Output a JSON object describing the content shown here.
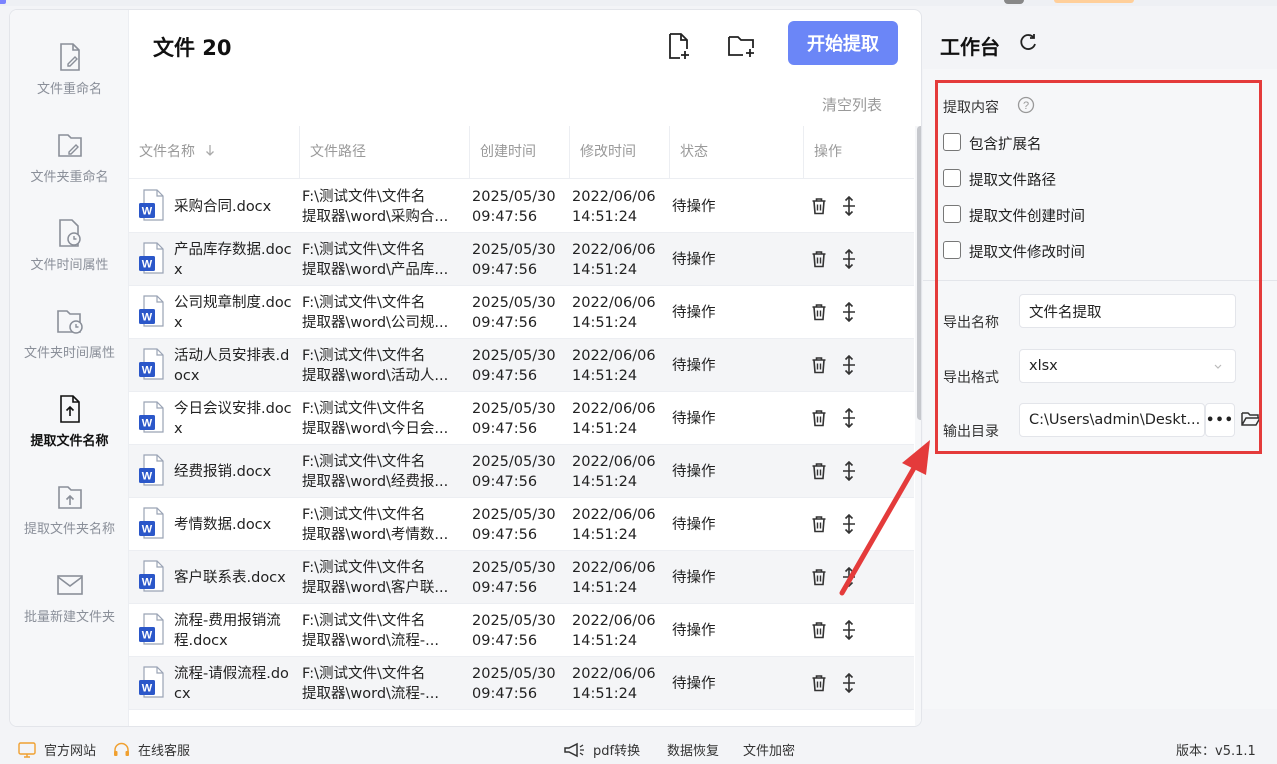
{
  "sidebar": {
    "items": [
      {
        "label": "文件重命名",
        "icon": "file-edit-icon",
        "active": false
      },
      {
        "label": "文件夹重命名",
        "icon": "folder-icon",
        "active": false
      },
      {
        "label": "文件时间属性",
        "icon": "file-clock-icon",
        "active": false
      },
      {
        "label": "文件夹时间属性",
        "icon": "folder-clock-icon",
        "active": false
      },
      {
        "label": "提取文件名称",
        "icon": "file-upload-icon",
        "active": true
      },
      {
        "label": "提取文件夹名称",
        "icon": "folder-upload-icon",
        "active": false
      },
      {
        "label": "批量新建文件夹",
        "icon": "folder-mail-icon",
        "active": false
      }
    ]
  },
  "header": {
    "file_count_title": "文件 20",
    "add_file_icon": "add-file-icon",
    "add_folder_icon": "add-folder-icon",
    "start_button": "开始提取",
    "clear_list": "清空列表"
  },
  "table": {
    "columns": [
      "文件名称",
      "文件路径",
      "创建时间",
      "修改时间",
      "状态",
      "操作"
    ],
    "sort_icon": "arrow-down-icon",
    "rows": [
      {
        "name": "采购合同.docx",
        "path1": "F:\\测试文件\\文件名",
        "path2": "提取器\\word\\采购合...",
        "created1": "2025/05/30",
        "created2": "09:47:56",
        "modified1": "2022/06/06",
        "modified2": "14:51:24",
        "status": "待操作"
      },
      {
        "name": "产品库存数据.docx",
        "path1": "F:\\测试文件\\文件名",
        "path2": "提取器\\word\\产品库...",
        "created1": "2025/05/30",
        "created2": "09:47:56",
        "modified1": "2022/06/06",
        "modified2": "14:51:24",
        "status": "待操作"
      },
      {
        "name": "公司规章制度.docx",
        "path1": "F:\\测试文件\\文件名",
        "path2": "提取器\\word\\公司规...",
        "created1": "2025/05/30",
        "created2": "09:47:56",
        "modified1": "2022/06/06",
        "modified2": "14:51:24",
        "status": "待操作"
      },
      {
        "name": "活动人员安排表.docx",
        "path1": "F:\\测试文件\\文件名",
        "path2": "提取器\\word\\活动人...",
        "created1": "2025/05/30",
        "created2": "09:47:56",
        "modified1": "2022/06/06",
        "modified2": "14:51:24",
        "status": "待操作"
      },
      {
        "name": "今日会议安排.docx",
        "path1": "F:\\测试文件\\文件名",
        "path2": "提取器\\word\\今日会...",
        "created1": "2025/05/30",
        "created2": "09:47:56",
        "modified1": "2022/06/06",
        "modified2": "14:51:24",
        "status": "待操作"
      },
      {
        "name": "经费报销.docx",
        "path1": "F:\\测试文件\\文件名",
        "path2": "提取器\\word\\经费报...",
        "created1": "2025/05/30",
        "created2": "09:47:56",
        "modified1": "2022/06/06",
        "modified2": "14:51:24",
        "status": "待操作"
      },
      {
        "name": "考情数据.docx",
        "path1": "F:\\测试文件\\文件名",
        "path2": "提取器\\word\\考情数...",
        "created1": "2025/05/30",
        "created2": "09:47:56",
        "modified1": "2022/06/06",
        "modified2": "14:51:24",
        "status": "待操作"
      },
      {
        "name": "客户联系表.docx",
        "path1": "F:\\测试文件\\文件名",
        "path2": "提取器\\word\\客户联...",
        "created1": "2025/05/30",
        "created2": "09:47:56",
        "modified1": "2022/06/06",
        "modified2": "14:51:24",
        "status": "待操作"
      },
      {
        "name": "流程-费用报销流程.docx",
        "path1": "F:\\测试文件\\文件名",
        "path2": "提取器\\word\\流程-...",
        "created1": "2025/05/30",
        "created2": "09:47:56",
        "modified1": "2022/06/06",
        "modified2": "14:51:24",
        "status": "待操作"
      },
      {
        "name": "流程-请假流程.docx",
        "path1": "F:\\测试文件\\文件名",
        "path2": "提取器\\word\\流程-...",
        "created1": "2025/05/30",
        "created2": "09:47:56",
        "modified1": "2022/06/06",
        "modified2": "14:51:24",
        "status": "待操作"
      }
    ]
  },
  "workspace": {
    "title": "工作台",
    "refresh_icon": "refresh-icon",
    "content_label": "提取内容",
    "help_icon": "help-icon",
    "options": [
      "包含扩展名",
      "提取文件路径",
      "提取文件创建时间",
      "提取文件修改时间"
    ],
    "export_name_label": "导出名称",
    "export_name_value": "文件名提取",
    "export_format_label": "导出格式",
    "export_format_value": "xlsx",
    "output_dir_label": "输出目录",
    "output_dir_value": "C:\\Users\\admin\\Deskt...",
    "more_button": "•••",
    "folder_icon": "open-folder-icon",
    "highlight_color": "#e43b3b"
  },
  "footer": {
    "official_site": "官方网站",
    "online_service": "在线客服",
    "pdf_convert": "pdf转换",
    "data_recovery": "数据恢复",
    "file_encrypt": "文件加密",
    "version": "版本：v5.1.1"
  },
  "colors": {
    "accent": "#6b86f7",
    "word_blue": "#2b57c9"
  }
}
